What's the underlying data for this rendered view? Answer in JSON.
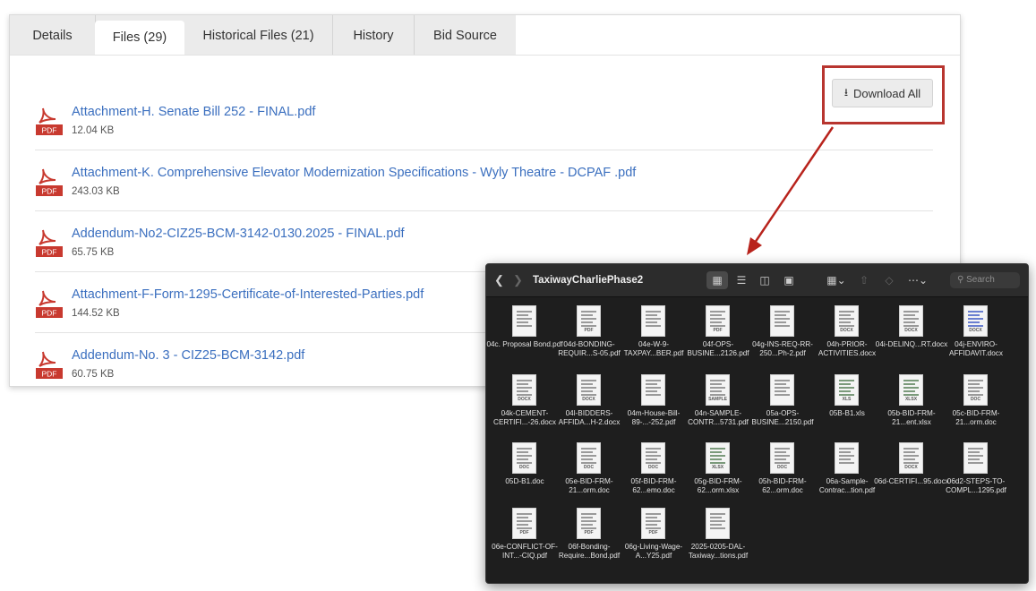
{
  "tabs": [
    {
      "label": "Details",
      "active": false
    },
    {
      "label": "Files (29)",
      "active": true
    },
    {
      "label": "Historical Files (21)",
      "active": false
    },
    {
      "label": "History",
      "active": false
    },
    {
      "label": "Bid Source",
      "active": false
    }
  ],
  "download_all_label": "Download All",
  "pdf_icon_tag": "PDF",
  "files": [
    {
      "name": "Attachment-H. Senate Bill 252 - FINAL.pdf",
      "size": "12.04 KB"
    },
    {
      "name": "Attachment-K. Comprehensive Elevator Modernization Specifications - Wyly Theatre - DCPAF .pdf",
      "size": "243.03 KB"
    },
    {
      "name": "Addendum-No2-CIZ25-BCM-3142-0130.2025 - FINAL.pdf",
      "size": "65.75 KB"
    },
    {
      "name": "Attachment-F-Form-1295-Certificate-of-Interested-Parties.pdf",
      "size": "144.52 KB"
    },
    {
      "name": "Addendum-No. 3 - CIZ25-BCM-3142.pdf",
      "size": "60.75 KB"
    }
  ],
  "finder": {
    "title": "TaxiwayCharliePhase2",
    "search_placeholder": "Search",
    "items": [
      {
        "name": "04c. Proposal Bond.pdf",
        "tag": ""
      },
      {
        "name": "04d-BONDING-REQUIR...S-05.pdf",
        "tag": "PDF"
      },
      {
        "name": "04e-W-9-TAXPAY...BER.pdf",
        "tag": ""
      },
      {
        "name": "04f-OPS-BUSINE...2126.pdf",
        "tag": "PDF"
      },
      {
        "name": "04g-INS-REQ-RR-250...Ph-2.pdf",
        "tag": ""
      },
      {
        "name": "04h-PRIOR-ACTIVITIES.docx",
        "tag": "DOCX"
      },
      {
        "name": "04i-DELINQ...RT.docx",
        "tag": "DOCX"
      },
      {
        "name": "04j-ENVIRO-AFFIDAVIT.docx",
        "tag": "DOCX"
      },
      {
        "name": "04k-CEMENT-CERTIFI...-26.docx",
        "tag": "DOCX"
      },
      {
        "name": "04l-BIDDERS-AFFIDA...H-2.docx",
        "tag": "DOCX"
      },
      {
        "name": "04m-House-Bill-89-...-252.pdf",
        "tag": ""
      },
      {
        "name": "04n-SAMPLE-CONTR...5731.pdf",
        "tag": "SAMPLE"
      },
      {
        "name": "05a-OPS-BUSINE...2150.pdf",
        "tag": ""
      },
      {
        "name": "05B-B1.xls",
        "tag": "XLS"
      },
      {
        "name": "05b-BID-FRM-21...ent.xlsx",
        "tag": "XLSX"
      },
      {
        "name": "05c-BID-FRM-21...orm.doc",
        "tag": "DOC"
      },
      {
        "name": "05D-B1.doc",
        "tag": "DOC"
      },
      {
        "name": "05e-BID-FRM-21...orm.doc",
        "tag": "DOC"
      },
      {
        "name": "05f-BID-FRM-62...emo.doc",
        "tag": "DOC"
      },
      {
        "name": "05g-BID-FRM-62...orm.xlsx",
        "tag": "XLSX"
      },
      {
        "name": "05h-BID-FRM-62...orm.doc",
        "tag": "DOC"
      },
      {
        "name": "06a-Sample-Contrac...tion.pdf",
        "tag": ""
      },
      {
        "name": "06d-CERTIFI...95.docx",
        "tag": "DOCX"
      },
      {
        "name": "06d2-STEPS-TO-COMPL...1295.pdf",
        "tag": ""
      },
      {
        "name": "06e-CONFLICT-OF-INT...-CIQ.pdf",
        "tag": "PDF"
      },
      {
        "name": "06f-Bonding-Require...Bond.pdf",
        "tag": "PDF"
      },
      {
        "name": "06g-Living-Wage-A...Y25.pdf",
        "tag": "PDF"
      },
      {
        "name": "2025-0205-DAL-Taxiway...tions.pdf",
        "tag": ""
      }
    ]
  }
}
